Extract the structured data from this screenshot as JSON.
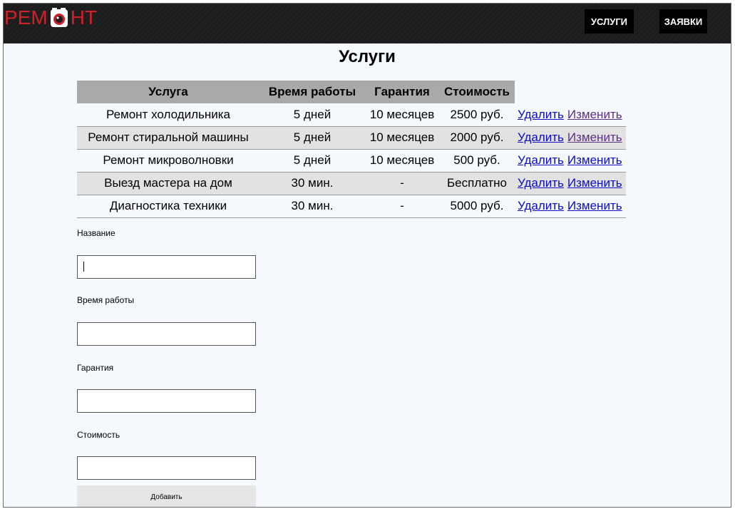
{
  "header": {
    "logo_left": "РЕМ",
    "logo_right": "НТ",
    "nav": {
      "services": "УСЛУГИ",
      "orders": "ЗАЯВКИ"
    }
  },
  "page": {
    "title": "Услуги"
  },
  "table": {
    "headers": [
      "Услуга",
      "Время работы",
      "Гарантия",
      "Стоимость"
    ],
    "rows": [
      {
        "name": "Ремонт холодильника",
        "time": "5 дней",
        "guarantee": "10 месяцев",
        "cost": "2500 руб.",
        "delete": "Удалить",
        "edit": "Изменить"
      },
      {
        "name": "Ремонт стиральной машины",
        "time": "5 дней",
        "guarantee": "10 месяцев",
        "cost": "2000 руб.",
        "delete": "Удалить",
        "edit": "Изменить"
      },
      {
        "name": "Ремонт микроволновки",
        "time": "5 дней",
        "guarantee": "10 месяцев",
        "cost": "500 руб.",
        "delete": "Удалить",
        "edit": "Изменить"
      },
      {
        "name": "Выезд мастера на дом",
        "time": "30 мин.",
        "guarantee": "-",
        "cost": "Бесплатно",
        "delete": "Удалить",
        "edit": "Изменить"
      },
      {
        "name": "Диагностика техники",
        "time": "30 мин.",
        "guarantee": "-",
        "cost": "5000 руб.",
        "delete": "Удалить",
        "edit": "Изменить"
      }
    ]
  },
  "form": {
    "name_label": "Название",
    "name_value": "",
    "time_label": "Время работы",
    "time_value": "",
    "guarantee_label": "Гарантия",
    "guarantee_value": "",
    "cost_label": "Стоимость",
    "cost_value": "",
    "submit": "Добавить"
  },
  "colors": {
    "brand": "#d0202a",
    "header_bg": "#1c1c1c",
    "link": "#0c0cc9",
    "visited_link": "#5d2f86",
    "table_header_bg": "#a9a9a9",
    "row_alt_bg": "#e2e2e2",
    "page_bg": "#f5f9fd"
  }
}
